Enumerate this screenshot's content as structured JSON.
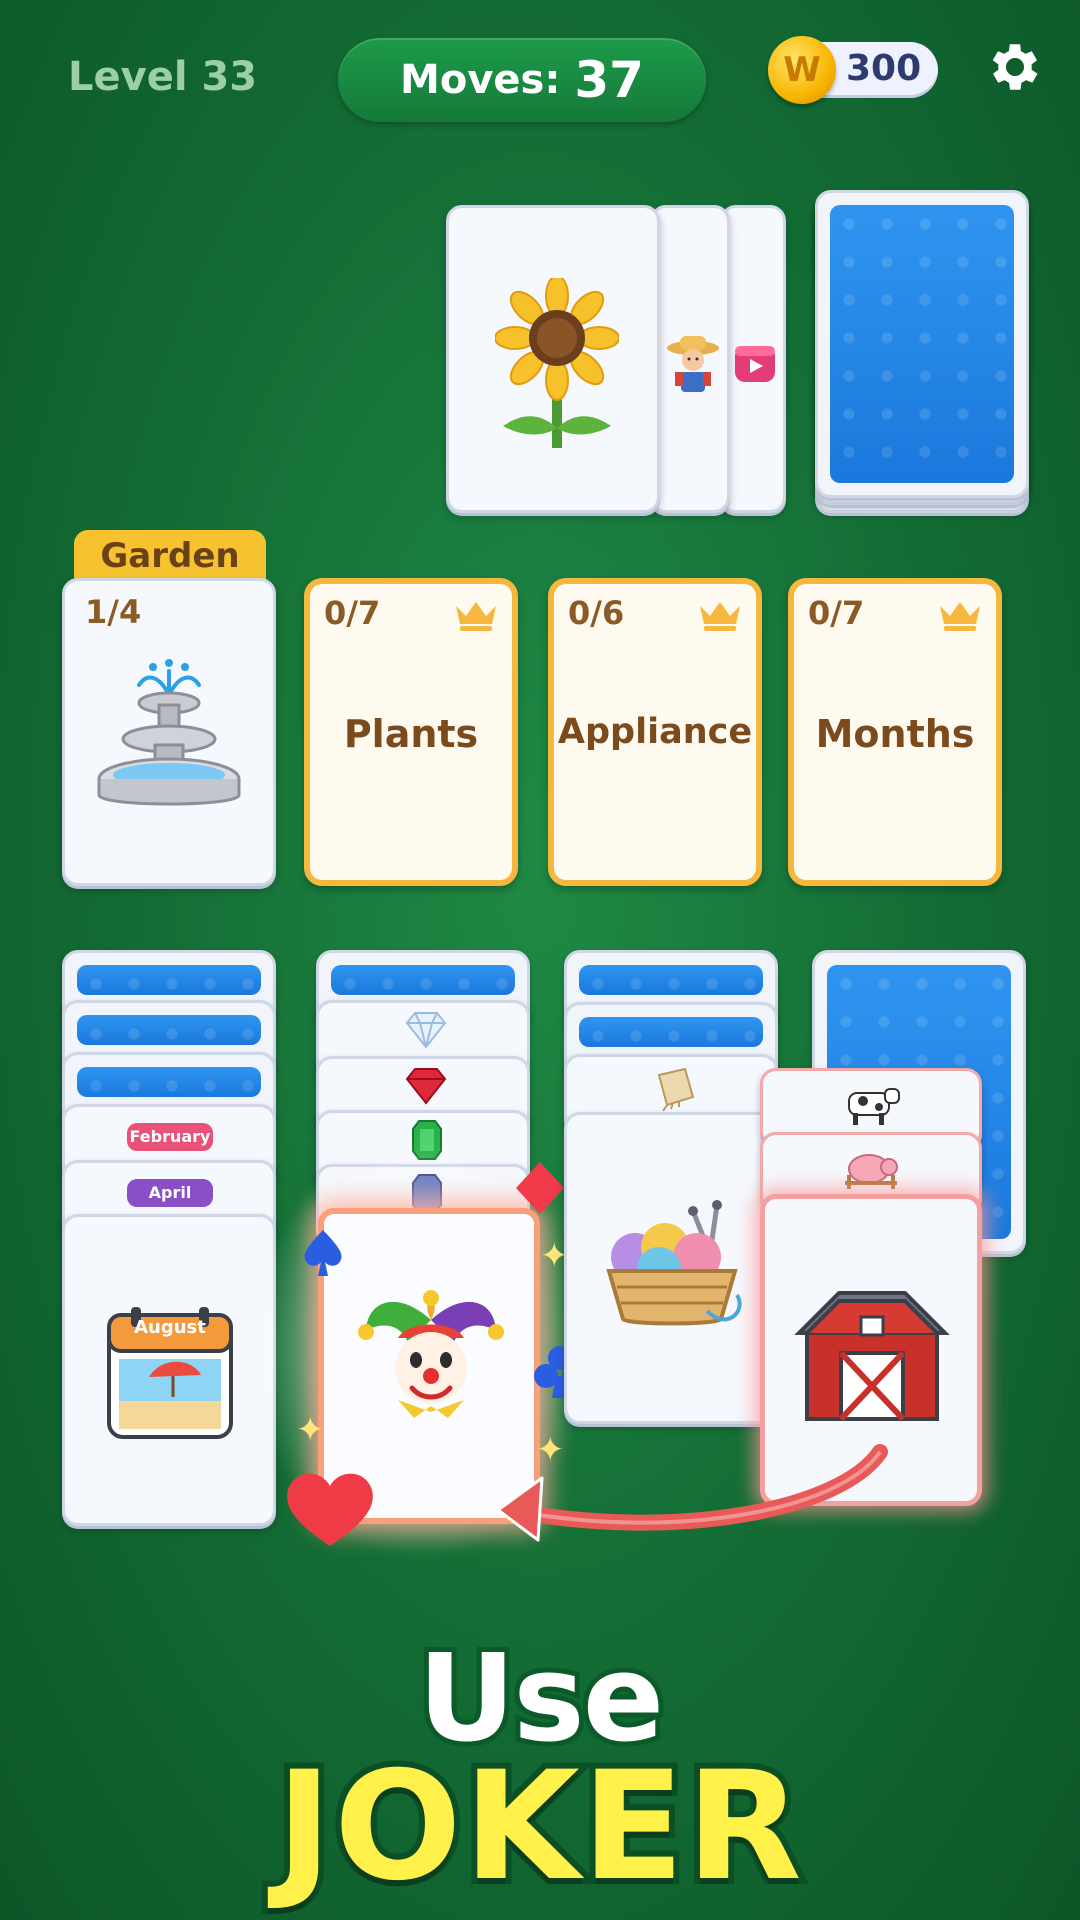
{
  "hud": {
    "level_label": "Level 33",
    "moves_label": "Moves:",
    "moves_value": "37",
    "coins": "300",
    "coin_icon": "W"
  },
  "garden": {
    "label": "Garden",
    "count": "1/4",
    "card_icon": "fountain-icon"
  },
  "categories": [
    {
      "count": "0/7",
      "name": "Plants"
    },
    {
      "count": "0/6",
      "name": "Appliance"
    },
    {
      "count": "0/7",
      "name": "Months"
    }
  ],
  "month_cards": {
    "feb": "February",
    "apr": "April",
    "aug": "August"
  },
  "promo": {
    "line1": "Use",
    "line2": "JOKER"
  },
  "colors": {
    "felt": "#136b34",
    "card_back": "#1b78dc",
    "category_border": "#f5b73d",
    "joker_text": "#fff04a"
  }
}
